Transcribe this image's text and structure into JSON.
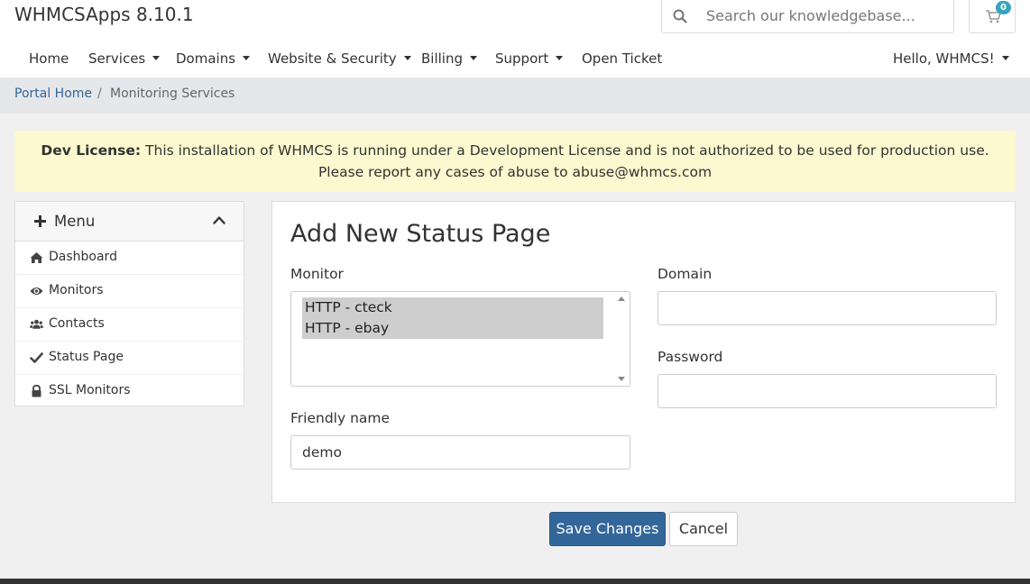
{
  "header": {
    "brand": "WHMCSApps 8.10.1",
    "search_placeholder": "Search our knowledgebase...",
    "cart_count": "0"
  },
  "nav": {
    "items": [
      {
        "label": "Home",
        "dropdown": false
      },
      {
        "label": "Services",
        "dropdown": true
      },
      {
        "label": "Domains",
        "dropdown": true
      },
      {
        "label": "Website & Security",
        "dropdown": true
      },
      {
        "label": "Billing",
        "dropdown": true
      },
      {
        "label": "Support",
        "dropdown": true
      },
      {
        "label": "Open Ticket",
        "dropdown": false
      }
    ],
    "user_greeting": "Hello, WHMCS!"
  },
  "breadcrumb": {
    "home": "Portal Home",
    "separator": "/",
    "current": "Monitoring Services"
  },
  "alert": {
    "strong": "Dev License:",
    "line1": " This installation of WHMCS is running under a Development License and is not authorized to be used for production use.",
    "line2": "Please report any cases of abuse to abuse@whmcs.com"
  },
  "sidebar": {
    "title": "Menu",
    "items": [
      {
        "label": "Dashboard",
        "icon": "home-icon"
      },
      {
        "label": "Monitors",
        "icon": "eye-icon"
      },
      {
        "label": "Contacts",
        "icon": "users-icon"
      },
      {
        "label": "Status Page",
        "icon": "check-icon"
      },
      {
        "label": "SSL Monitors",
        "icon": "lock-icon"
      }
    ]
  },
  "form": {
    "title": "Add New Status Page",
    "monitor_label": "Monitor",
    "monitor_options": [
      "HTTP - cteck",
      "HTTP - ebay"
    ],
    "domain_label": "Domain",
    "domain_value": "",
    "password_label": "Password",
    "password_value": "",
    "friendly_label": "Friendly name",
    "friendly_value": "demo"
  },
  "actions": {
    "save": "Save Changes",
    "cancel": "Cancel"
  },
  "colors": {
    "primary": "#336699",
    "alert_bg": "#fcf8cf",
    "badge": "#36a6bd"
  }
}
